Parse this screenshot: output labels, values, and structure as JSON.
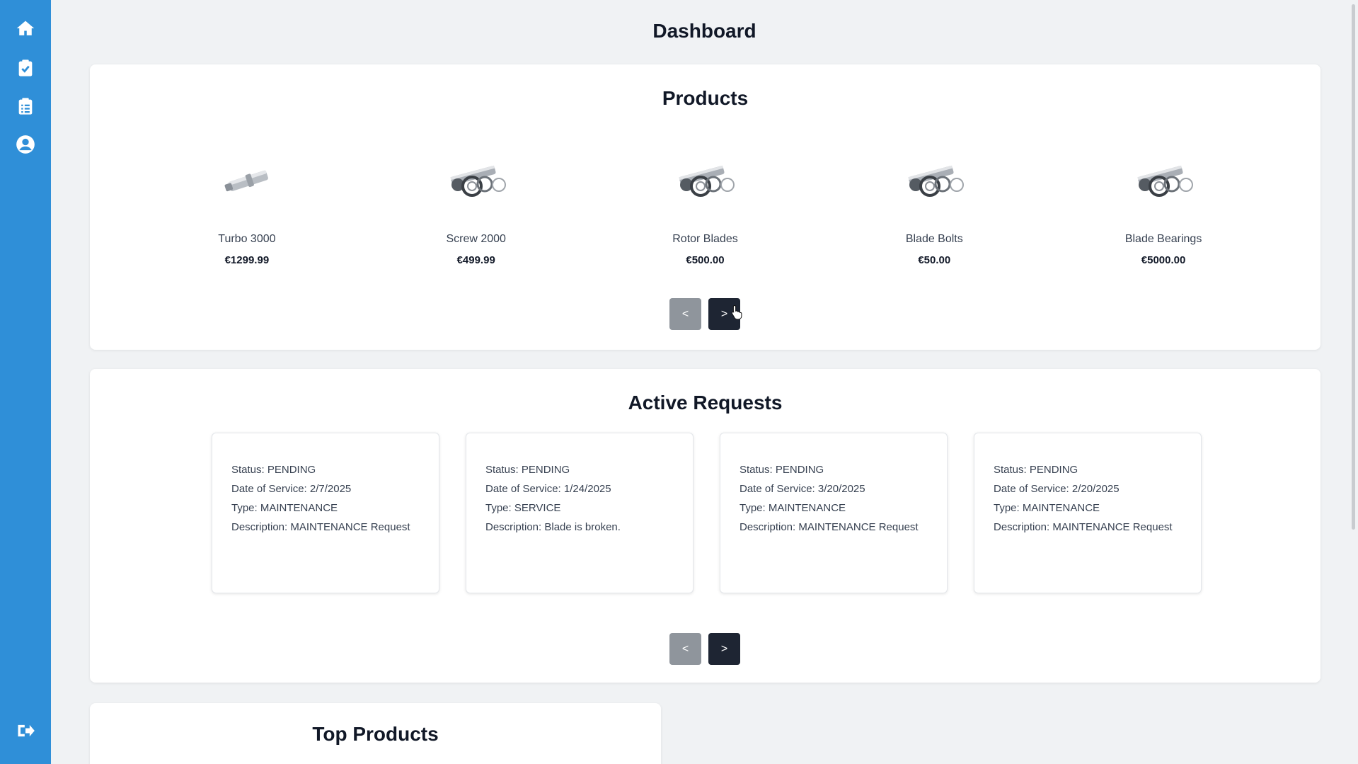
{
  "sidebar": {
    "items": [
      {
        "icon": "home-icon"
      },
      {
        "icon": "clipboard-check-icon"
      },
      {
        "icon": "clipboard-list-icon"
      },
      {
        "icon": "user-circle-icon"
      }
    ],
    "logout_icon": "sign-out-icon",
    "color": "#2f8fd8"
  },
  "page": {
    "title": "Dashboard"
  },
  "products": {
    "title": "Products",
    "items": [
      {
        "name": "Turbo 3000",
        "price": "€1299.99",
        "image": "shaft-part-image"
      },
      {
        "name": "Screw 2000",
        "price": "€499.99",
        "image": "bearing-kit-image"
      },
      {
        "name": "Rotor Blades",
        "price": "€500.00",
        "image": "bearing-kit-image"
      },
      {
        "name": "Blade Bolts",
        "price": "€50.00",
        "image": "bearing-kit-image"
      },
      {
        "name": "Blade Bearings",
        "price": "€5000.00",
        "image": "bearing-kit-image"
      }
    ],
    "prev_label": "<",
    "next_label": ">"
  },
  "requests": {
    "title": "Active Requests",
    "items": [
      {
        "status": "Status: PENDING",
        "date": "Date of Service: 2/7/2025",
        "type": "Type: MAINTENANCE",
        "description": "Description: MAINTENANCE Request"
      },
      {
        "status": "Status: PENDING",
        "date": "Date of Service: 1/24/2025",
        "type": "Type: SERVICE",
        "description": "Description: Blade is broken."
      },
      {
        "status": "Status: PENDING",
        "date": "Date of Service: 3/20/2025",
        "type": "Type: MAINTENANCE",
        "description": "Description: MAINTENANCE Request"
      },
      {
        "status": "Status: PENDING",
        "date": "Date of Service: 2/20/2025",
        "type": "Type: MAINTENANCE",
        "description": "Description: MAINTENANCE Request"
      }
    ],
    "prev_label": "<",
    "next_label": ">"
  },
  "top_products": {
    "title": "Top Products"
  }
}
